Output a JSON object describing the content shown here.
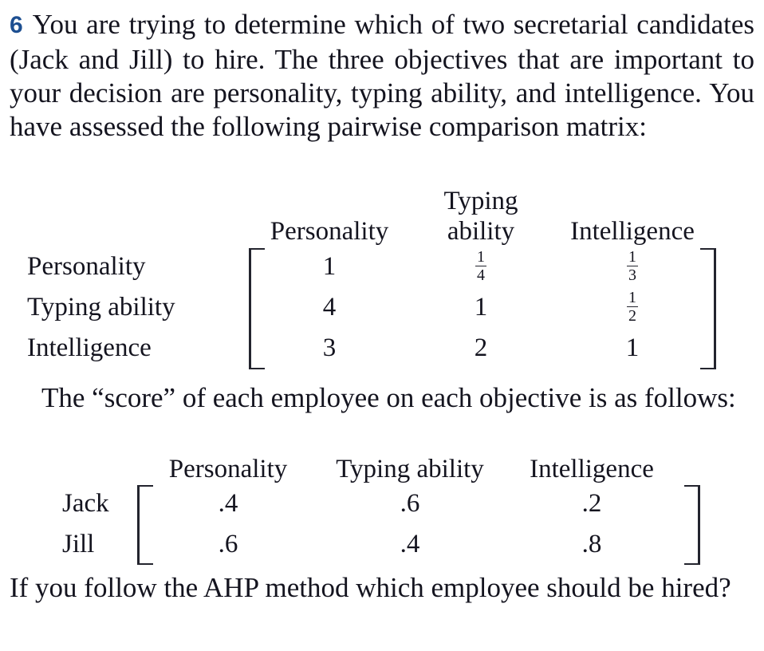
{
  "problem": {
    "number": "6",
    "intro_lines": [
      "You are trying to determine which of two secretarial",
      "candidates (Jack and Jill) to hire. The three objectives that",
      "are important to your decision are personality, typing ability,",
      "and intelligence. You have assessed the following pairwise",
      "comparison matrix:"
    ],
    "score_lines": [
      "The “score” of each employee on each objective is as",
      "follows:"
    ],
    "closing_lines": [
      "If you follow the AHP method which employee should be",
      "hired?"
    ]
  },
  "comparison_matrix": {
    "column_headers": [
      {
        "line1": "",
        "line2": "Personality"
      },
      {
        "line1": "Typing",
        "line2": "ability"
      },
      {
        "line1": "",
        "line2": "Intelligence"
      }
    ],
    "row_labels": [
      "Personality",
      "Typing ability",
      "Intelligence"
    ],
    "cells": [
      [
        {
          "text": "1"
        },
        {
          "num": "1",
          "den": "4"
        },
        {
          "num": "1",
          "den": "3"
        }
      ],
      [
        {
          "text": "4"
        },
        {
          "text": "1"
        },
        {
          "num": "1",
          "den": "2"
        }
      ],
      [
        {
          "text": "3"
        },
        {
          "text": "2"
        },
        {
          "text": "1"
        }
      ]
    ]
  },
  "score_matrix": {
    "column_headers": [
      "Personality",
      "Typing ability",
      "Intelligence"
    ],
    "row_labels": [
      "Jack",
      "Jill"
    ],
    "cells": [
      [
        ".4",
        ".6",
        ".2"
      ],
      [
        ".6",
        ".4",
        ".8"
      ]
    ]
  },
  "colors": {
    "question_number": "#1d4f91",
    "text": "#14141f",
    "bracket": "#23242e",
    "background": "#ffffff"
  }
}
